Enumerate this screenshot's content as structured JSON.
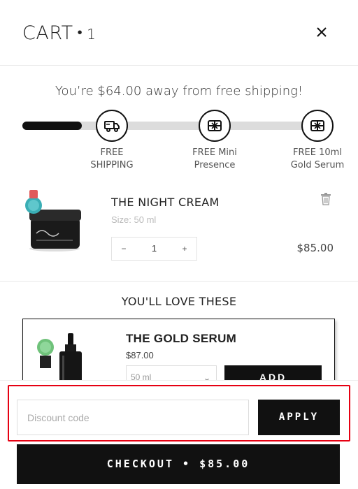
{
  "header": {
    "title": "CART",
    "separator": "•",
    "count": "1"
  },
  "shipping": {
    "message": "You’re $64.00 away from free shipping!",
    "progress_fraction": 0.19,
    "milestones": [
      {
        "line1": "FREE",
        "line2": "SHIPPING",
        "icon": "truck-icon"
      },
      {
        "line1": "FREE Mini",
        "line2": "Presence",
        "icon": "gift-icon"
      },
      {
        "line1": "FREE 10ml",
        "line2": "Gold Serum",
        "icon": "gift-icon"
      }
    ]
  },
  "cart_item": {
    "name": "THE NIGHT CREAM",
    "size": "Size: 50 ml",
    "quantity": "1",
    "minus": "−",
    "plus": "+",
    "price": "$85.00"
  },
  "upsell": {
    "section_title": "YOU'LL LOVE THESE",
    "name": "THE GOLD SERUM",
    "price": "$87.00",
    "variant": "50 ml",
    "add_label": "ADD"
  },
  "footer": {
    "discount_placeholder": "Discount code",
    "apply_label": "APPLY",
    "checkout_label": "CHECKOUT • $85.00"
  },
  "colors": {
    "accent": "#111111",
    "highlight": "#e60012",
    "track": "#dcdcdc"
  }
}
